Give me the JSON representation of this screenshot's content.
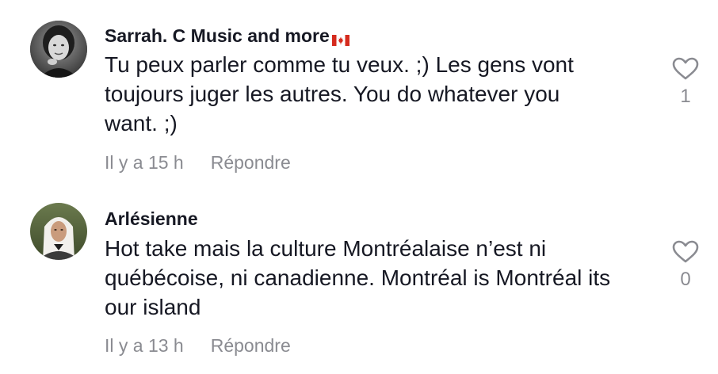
{
  "comments": [
    {
      "username": "Sarrah. C Music and more",
      "flag_icon": "canada-flag-icon",
      "text_lines": [
        "Tu peux parler comme tu veux. ;) Les gens vont",
        "toujours juger les autres. You do whatever you",
        "want. ;)"
      ],
      "time": "Il y a 15 h",
      "reply_label": "Répondre",
      "likes": "1"
    },
    {
      "username": "Arlésienne",
      "text_lines": [
        "Hot take mais la culture Montréalaise n’est ni",
        "québécoise, ni canadienne. Montréal is Montréal its",
        "our island"
      ],
      "time": "Il y a 13 h",
      "reply_label": "Répondre",
      "likes": "0"
    }
  ],
  "colors": {
    "text_primary": "#161823",
    "text_secondary": "#8a8b91",
    "heart_outline": "#8a8b91",
    "flag_red": "#d52b1e"
  }
}
